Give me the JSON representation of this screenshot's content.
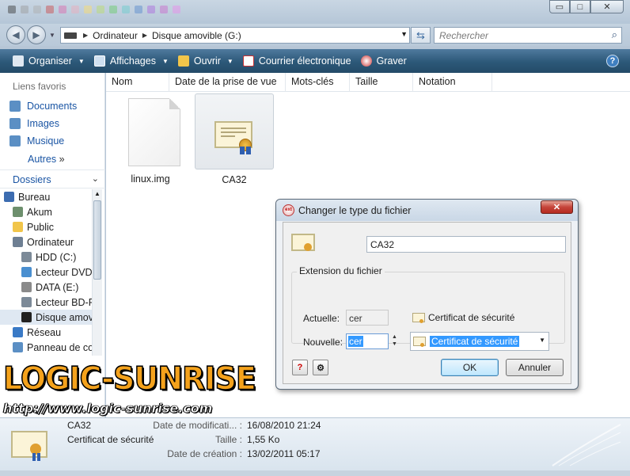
{
  "window": {
    "min_label": "▭",
    "max_label": "□",
    "close_label": "✕"
  },
  "address": {
    "crumbs": [
      "Ordinateur",
      "Disque amovible (G:)"
    ],
    "search_placeholder": "Rechercher"
  },
  "toolbar": {
    "items": [
      {
        "label": "Organiser",
        "icon": "organize-icon",
        "dropdown": true
      },
      {
        "label": "Affichages",
        "icon": "views-icon",
        "dropdown": true
      },
      {
        "label": "Ouvrir",
        "icon": "folder-icon",
        "dropdown": true
      },
      {
        "label": "Courrier électronique",
        "icon": "email-icon",
        "dropdown": false
      },
      {
        "label": "Graver",
        "icon": "burn-icon",
        "dropdown": false
      }
    ],
    "help": "?"
  },
  "sidebar": {
    "favorites_title": "Liens favoris",
    "favorites": [
      "Documents",
      "Images",
      "Musique"
    ],
    "more": "Autres",
    "more_glyph": "»",
    "folders_title": "Dossiers",
    "tree": [
      {
        "label": "Bureau",
        "indent": 0
      },
      {
        "label": "Akum",
        "indent": 1
      },
      {
        "label": "Public",
        "indent": 1
      },
      {
        "label": "Ordinateur",
        "indent": 1
      },
      {
        "label": "HDD (C:)",
        "indent": 2
      },
      {
        "label": "Lecteur DVD",
        "indent": 2
      },
      {
        "label": "DATA (E:)",
        "indent": 2
      },
      {
        "label": "Lecteur BD-R",
        "indent": 2
      },
      {
        "label": "Disque amov",
        "indent": 2,
        "selected": true
      },
      {
        "label": "Réseau",
        "indent": 1
      },
      {
        "label": "Panneau de co",
        "indent": 1
      }
    ]
  },
  "main": {
    "columns": [
      "Nom",
      "Date de la prise de vue",
      "Mots-clés",
      "Taille",
      "Notation"
    ],
    "files": [
      {
        "name": "linux.img",
        "kind": "blank"
      },
      {
        "name": "CA32",
        "kind": "certificate",
        "selected": true
      }
    ]
  },
  "dialog": {
    "title": "Changer le type du fichier",
    "close": "✕",
    "filename": "CA32",
    "group_label": "Extension du fichier",
    "current_label": "Actuelle:",
    "current_ext": "cer",
    "current_type": "Certificat de sécurité",
    "new_label": "Nouvelle:",
    "new_ext": "cer",
    "new_type": "Certificat de sécurité",
    "help_btn": "?",
    "ok": "OK",
    "cancel": "Annuler"
  },
  "logo": {
    "main": "LOGIC-SUNRISE",
    "url": "http://www.logic-sunrise.com"
  },
  "details": {
    "name": "CA32",
    "type": "Certificat de sécurité",
    "modified_label": "Date de modificati... :",
    "modified_value": "16/08/2010 21:24",
    "size_label": "Taille :",
    "size_value": "1,55 Ko",
    "created_label": "Date de création :",
    "created_value": "13/02/2011 05:17"
  }
}
